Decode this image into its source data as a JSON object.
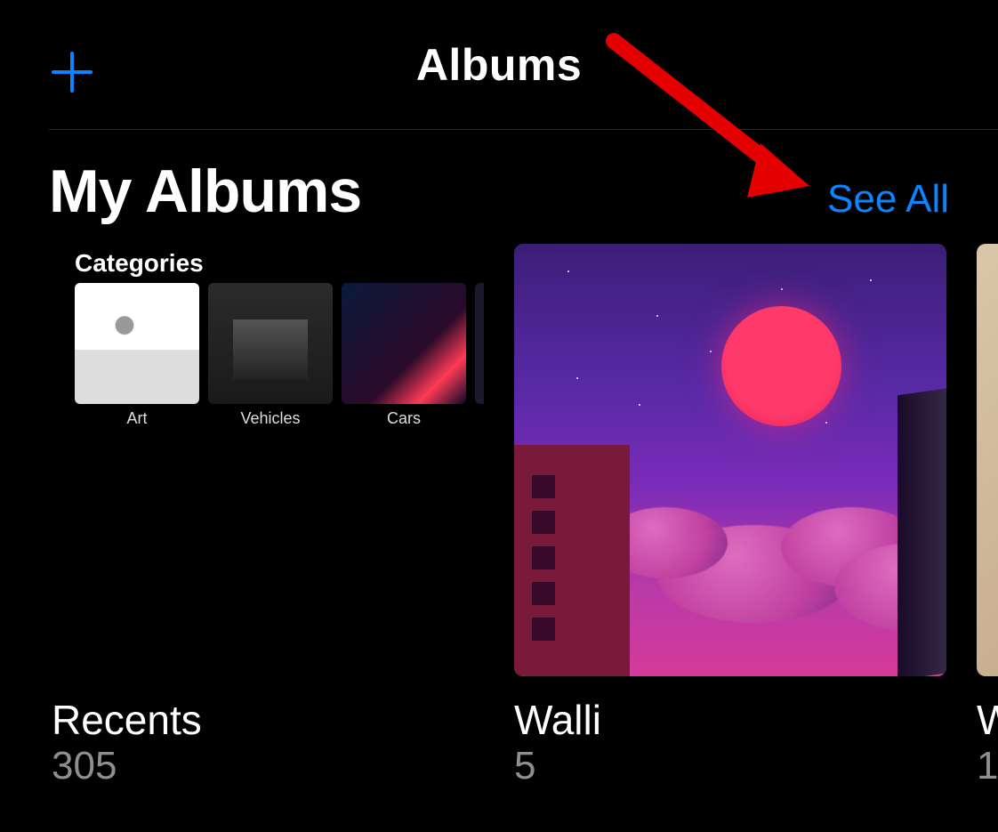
{
  "header": {
    "title": "Albums"
  },
  "section": {
    "title": "My Albums",
    "see_all": "See All"
  },
  "albums": [
    {
      "name": "Recents",
      "count": "305",
      "categories_label": "Categories",
      "categories": [
        {
          "label": "Art"
        },
        {
          "label": "Vehicles"
        },
        {
          "label": "Cars"
        }
      ]
    },
    {
      "name": "Walli",
      "count": "5"
    },
    {
      "name": "W",
      "count": "1"
    }
  ],
  "accent_color": "#0a84ff"
}
